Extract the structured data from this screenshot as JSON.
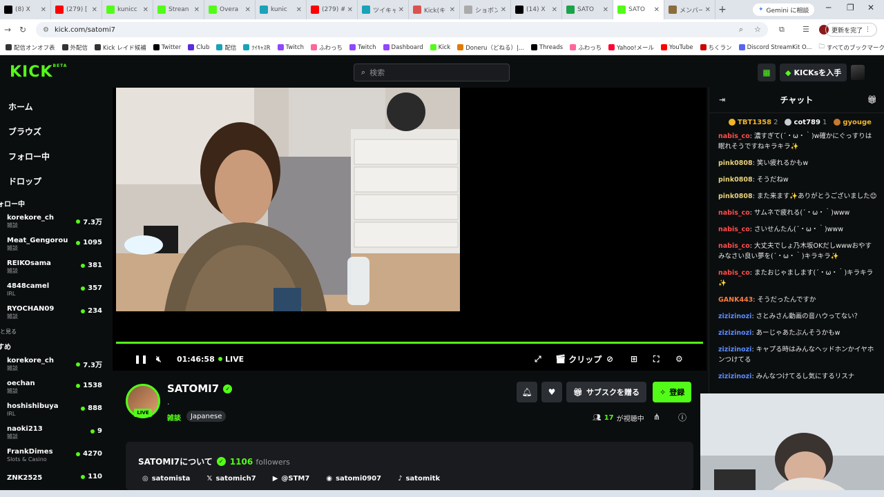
{
  "browser": {
    "tabs": [
      {
        "label": "(8) X",
        "color": "#000000"
      },
      {
        "label": "(279) [",
        "color": "#ff0000"
      },
      {
        "label": "kunicc",
        "color": "#53fc18"
      },
      {
        "label": "Strean",
        "color": "#53fc18"
      },
      {
        "label": "Overa",
        "color": "#53fc18"
      },
      {
        "label": "kunic",
        "color": "#1aa3b8"
      },
      {
        "label": "(279) #",
        "color": "#ff0000"
      },
      {
        "label": "ツイキャ",
        "color": "#1aa3b8"
      },
      {
        "label": "Kick(キ",
        "color": "#d9534f"
      },
      {
        "label": "ショボン",
        "color": "#aaaaaa"
      },
      {
        "label": "(14) X",
        "color": "#000000"
      },
      {
        "label": "SATO",
        "color": "#1aa34a"
      },
      {
        "label": "SATO",
        "color": "#53fc18",
        "active": true
      },
      {
        "label": "メンバー",
        "color": "#8a6d3b"
      }
    ],
    "gemini_label": "Gemini に相談",
    "url": "kick.com/satomi7",
    "update_label": "更新を完了",
    "bookmarks": [
      {
        "label": "配信オンオフ表",
        "color": "#333333"
      },
      {
        "label": "外配信",
        "color": "#333333"
      },
      {
        "label": "Kick レイド候補",
        "color": "#333333"
      },
      {
        "label": "Twitter",
        "color": "#000000"
      },
      {
        "label": "Club",
        "color": "#5b2be0"
      },
      {
        "label": "配信",
        "color": "#1aa3b8"
      },
      {
        "label": "ﾂｲｷｬｽR",
        "color": "#1aa3b8"
      },
      {
        "label": "Twitch",
        "color": "#9146ff"
      },
      {
        "label": "ふわっち",
        "color": "#ff6699"
      },
      {
        "label": "Twitch",
        "color": "#9146ff"
      },
      {
        "label": "Dashboard",
        "color": "#9146ff"
      },
      {
        "label": "Kick",
        "color": "#53fc18"
      },
      {
        "label": "Doneru（どねる）|...",
        "color": "#e07b00"
      },
      {
        "label": "Threads",
        "color": "#000000"
      },
      {
        "label": "ふわっち",
        "color": "#ff6699"
      },
      {
        "label": "Yahoo!メール",
        "color": "#ff0033"
      },
      {
        "label": "YouTube",
        "color": "#ff0000"
      },
      {
        "label": "ちくラン",
        "color": "#cc0000"
      },
      {
        "label": "Discord StreamKit O...",
        "color": "#5865f2"
      }
    ],
    "all_bookmarks": "すべてのブックマーク"
  },
  "kick": {
    "logo": "KICK",
    "logo_beta": "BETA",
    "search_placeholder": "検索",
    "get_kicks": "KICKsを入手",
    "nav": [
      "ホーム",
      "ブラウズ",
      "フォロー中",
      "ドロップ"
    ],
    "following_title": "ォロー中",
    "following": [
      {
        "name": "korekore_ch",
        "cat": "雑談",
        "viewers": "7.3万"
      },
      {
        "name": "Meat_Gengorou",
        "cat": "雑談",
        "viewers": "1095"
      },
      {
        "name": "REIKOsama",
        "cat": "雑談",
        "viewers": "381"
      },
      {
        "name": "4848camel",
        "cat": "IRL",
        "viewers": "357"
      },
      {
        "name": "RYOCHAN09",
        "cat": "雑談",
        "viewers": "234"
      }
    ],
    "show_more": "と見る",
    "recommended_title": "すめ",
    "recommended": [
      {
        "name": "korekore_ch",
        "cat": "雑談",
        "viewers": "7.3万"
      },
      {
        "name": "oechan",
        "cat": "雑談",
        "viewers": "1538"
      },
      {
        "name": "hoshishibuya",
        "cat": "IRL",
        "viewers": "888"
      },
      {
        "name": "naoki213",
        "cat": "雑談",
        "viewers": "9"
      },
      {
        "name": "FrankDimes",
        "cat": "Slots & Casino",
        "viewers": "4270"
      },
      {
        "name": "ZNK2525",
        "cat": "",
        "viewers": "110"
      }
    ]
  },
  "player": {
    "time": "01:46:58",
    "live": "LIVE",
    "clip": "クリップ",
    "progress": 1.0
  },
  "channel": {
    "name": "SATOMI7",
    "subtitle": ".",
    "live_badge": "LIVE",
    "category": "雑談",
    "tag": "Japanese",
    "gift_subs": "サブスクを贈る",
    "follow": "登録",
    "viewers_count": "17",
    "viewers_label": "が視聴中",
    "about_title": "SATOMI7について",
    "followers_count": "1106",
    "followers_label": "followers",
    "socials": [
      {
        "icon": "instagram-icon",
        "label": "satomista"
      },
      {
        "icon": "x-icon",
        "label": "satomich7"
      },
      {
        "icon": "youtube-icon",
        "label": "@STM7"
      },
      {
        "icon": "discord-icon",
        "label": "satomi0907"
      },
      {
        "icon": "tiktok-icon",
        "label": "satomitk"
      }
    ]
  },
  "chat": {
    "title": "チャット",
    "gifters": [
      {
        "name": "TBT1358",
        "count": "2",
        "color": "#f0b429"
      },
      {
        "name": "cot789",
        "count": "1",
        "color": "#c9ccd1"
      },
      {
        "name": "gyouge",
        "count": "",
        "color": "#c87a2b"
      }
    ],
    "messages": [
      {
        "user": "nabis_co",
        "color": "#ff4d4d",
        "text": "濃すぎて(´・ω・｀)w確かにぐっすりは眠れそうですねキラキラ✨"
      },
      {
        "user": "pink0808",
        "color": "#e6d27a",
        "text": "笑い疲れるかもw"
      },
      {
        "user": "pink0808",
        "color": "#e6d27a",
        "text": "そうだねw"
      },
      {
        "user": "pink0808",
        "color": "#e6d27a",
        "text": "また来ます✨ありがとうございました😊"
      },
      {
        "user": "nabis_co",
        "color": "#ff4d4d",
        "text": "サムネで疲れる(´・ω・｀)www"
      },
      {
        "user": "nabis_co",
        "color": "#ff4d4d",
        "text": "さいせんたん(´・ω・｀)www"
      },
      {
        "user": "nabis_co",
        "color": "#ff4d4d",
        "text": "大丈夫でしょ乃木坂OKだしwwwおやすみなさい良い夢を(´・ω・｀)キラキラ✨"
      },
      {
        "user": "nabis_co",
        "color": "#ff4d4d",
        "text": "またおじゃまします(´・ω・｀)キラキラ✨"
      },
      {
        "user": "GANK443",
        "color": "#ff7a3d",
        "text": "そうだったんですか"
      },
      {
        "user": "zizizinozi",
        "color": "#5b8cff",
        "text": "さとみさん動画の音ハウってない？"
      },
      {
        "user": "zizizinozi",
        "color": "#5b8cff",
        "text": "あーじゃあたぶんそうかもw"
      },
      {
        "user": "zizizinozi",
        "color": "#5b8cff",
        "text": "キャプる時はみんなヘッドホンかイヤホンつけてる"
      },
      {
        "user": "zizizinozi",
        "color": "#5b8cff",
        "text": "みんなつけてるし気にするリスナ"
      }
    ]
  },
  "colors": {
    "accent": "#53fc18",
    "bg": "#0b0e0f",
    "panel": "#191b1f"
  }
}
